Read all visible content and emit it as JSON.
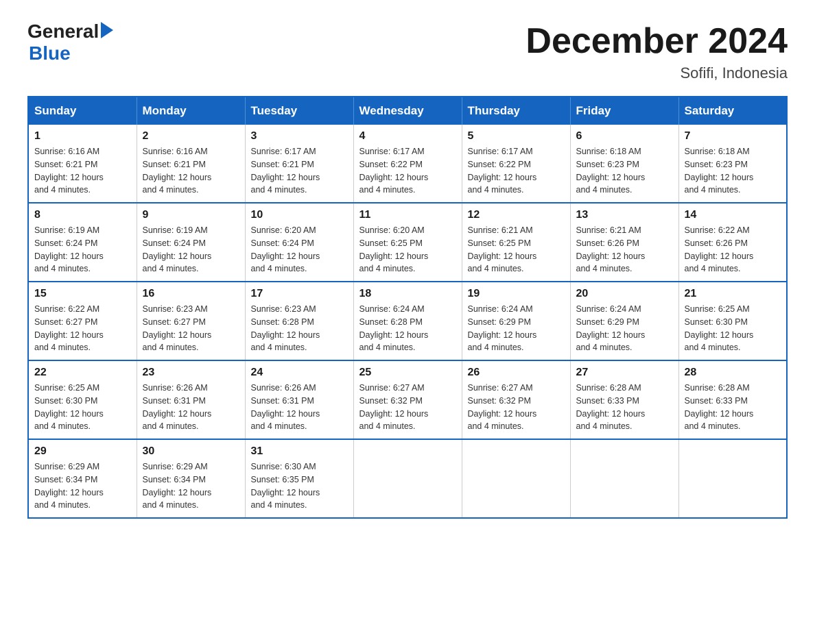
{
  "header": {
    "month_title": "December 2024",
    "location": "Sofifi, Indonesia",
    "logo_general": "General",
    "logo_blue": "Blue"
  },
  "days_of_week": [
    "Sunday",
    "Monday",
    "Tuesday",
    "Wednesday",
    "Thursday",
    "Friday",
    "Saturday"
  ],
  "weeks": [
    [
      {
        "day": "1",
        "sunrise": "6:16 AM",
        "sunset": "6:21 PM",
        "daylight": "12 hours and 4 minutes."
      },
      {
        "day": "2",
        "sunrise": "6:16 AM",
        "sunset": "6:21 PM",
        "daylight": "12 hours and 4 minutes."
      },
      {
        "day": "3",
        "sunrise": "6:17 AM",
        "sunset": "6:21 PM",
        "daylight": "12 hours and 4 minutes."
      },
      {
        "day": "4",
        "sunrise": "6:17 AM",
        "sunset": "6:22 PM",
        "daylight": "12 hours and 4 minutes."
      },
      {
        "day": "5",
        "sunrise": "6:17 AM",
        "sunset": "6:22 PM",
        "daylight": "12 hours and 4 minutes."
      },
      {
        "day": "6",
        "sunrise": "6:18 AM",
        "sunset": "6:23 PM",
        "daylight": "12 hours and 4 minutes."
      },
      {
        "day": "7",
        "sunrise": "6:18 AM",
        "sunset": "6:23 PM",
        "daylight": "12 hours and 4 minutes."
      }
    ],
    [
      {
        "day": "8",
        "sunrise": "6:19 AM",
        "sunset": "6:24 PM",
        "daylight": "12 hours and 4 minutes."
      },
      {
        "day": "9",
        "sunrise": "6:19 AM",
        "sunset": "6:24 PM",
        "daylight": "12 hours and 4 minutes."
      },
      {
        "day": "10",
        "sunrise": "6:20 AM",
        "sunset": "6:24 PM",
        "daylight": "12 hours and 4 minutes."
      },
      {
        "day": "11",
        "sunrise": "6:20 AM",
        "sunset": "6:25 PM",
        "daylight": "12 hours and 4 minutes."
      },
      {
        "day": "12",
        "sunrise": "6:21 AM",
        "sunset": "6:25 PM",
        "daylight": "12 hours and 4 minutes."
      },
      {
        "day": "13",
        "sunrise": "6:21 AM",
        "sunset": "6:26 PM",
        "daylight": "12 hours and 4 minutes."
      },
      {
        "day": "14",
        "sunrise": "6:22 AM",
        "sunset": "6:26 PM",
        "daylight": "12 hours and 4 minutes."
      }
    ],
    [
      {
        "day": "15",
        "sunrise": "6:22 AM",
        "sunset": "6:27 PM",
        "daylight": "12 hours and 4 minutes."
      },
      {
        "day": "16",
        "sunrise": "6:23 AM",
        "sunset": "6:27 PM",
        "daylight": "12 hours and 4 minutes."
      },
      {
        "day": "17",
        "sunrise": "6:23 AM",
        "sunset": "6:28 PM",
        "daylight": "12 hours and 4 minutes."
      },
      {
        "day": "18",
        "sunrise": "6:24 AM",
        "sunset": "6:28 PM",
        "daylight": "12 hours and 4 minutes."
      },
      {
        "day": "19",
        "sunrise": "6:24 AM",
        "sunset": "6:29 PM",
        "daylight": "12 hours and 4 minutes."
      },
      {
        "day": "20",
        "sunrise": "6:24 AM",
        "sunset": "6:29 PM",
        "daylight": "12 hours and 4 minutes."
      },
      {
        "day": "21",
        "sunrise": "6:25 AM",
        "sunset": "6:30 PM",
        "daylight": "12 hours and 4 minutes."
      }
    ],
    [
      {
        "day": "22",
        "sunrise": "6:25 AM",
        "sunset": "6:30 PM",
        "daylight": "12 hours and 4 minutes."
      },
      {
        "day": "23",
        "sunrise": "6:26 AM",
        "sunset": "6:31 PM",
        "daylight": "12 hours and 4 minutes."
      },
      {
        "day": "24",
        "sunrise": "6:26 AM",
        "sunset": "6:31 PM",
        "daylight": "12 hours and 4 minutes."
      },
      {
        "day": "25",
        "sunrise": "6:27 AM",
        "sunset": "6:32 PM",
        "daylight": "12 hours and 4 minutes."
      },
      {
        "day": "26",
        "sunrise": "6:27 AM",
        "sunset": "6:32 PM",
        "daylight": "12 hours and 4 minutes."
      },
      {
        "day": "27",
        "sunrise": "6:28 AM",
        "sunset": "6:33 PM",
        "daylight": "12 hours and 4 minutes."
      },
      {
        "day": "28",
        "sunrise": "6:28 AM",
        "sunset": "6:33 PM",
        "daylight": "12 hours and 4 minutes."
      }
    ],
    [
      {
        "day": "29",
        "sunrise": "6:29 AM",
        "sunset": "6:34 PM",
        "daylight": "12 hours and 4 minutes."
      },
      {
        "day": "30",
        "sunrise": "6:29 AM",
        "sunset": "6:34 PM",
        "daylight": "12 hours and 4 minutes."
      },
      {
        "day": "31",
        "sunrise": "6:30 AM",
        "sunset": "6:35 PM",
        "daylight": "12 hours and 4 minutes."
      },
      null,
      null,
      null,
      null
    ]
  ],
  "labels": {
    "sunrise": "Sunrise:",
    "sunset": "Sunset:",
    "daylight": "Daylight:"
  }
}
